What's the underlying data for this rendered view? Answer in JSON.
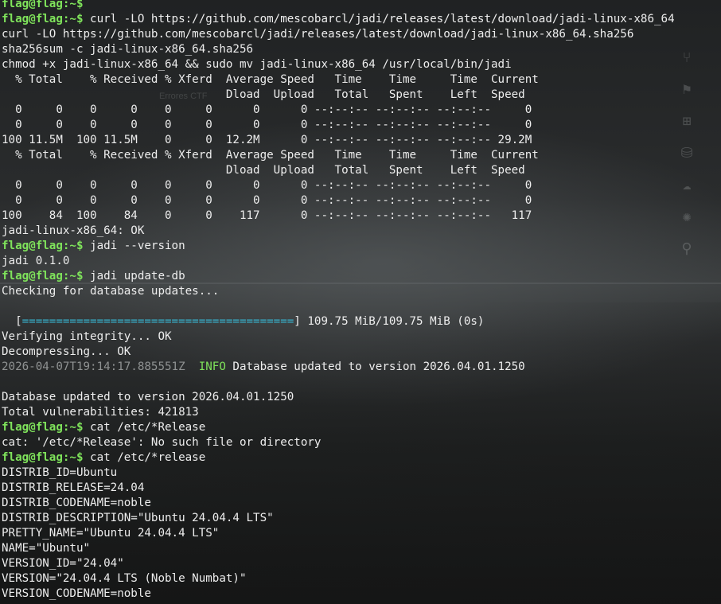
{
  "terminal": {
    "prompt": "flag@flag:~$",
    "lines": [
      {
        "type": "prompt",
        "cmd": ""
      },
      {
        "type": "prompt",
        "cmd": " curl -LO https://github.com/mescobarcl/jadi/releases/latest/download/jadi-linux-x86_64"
      },
      {
        "type": "text",
        "text": "curl -LO https://github.com/mescobarcl/jadi/releases/latest/download/jadi-linux-x86_64.sha256"
      },
      {
        "type": "text",
        "text": "sha256sum -c jadi-linux-x86_64.sha256"
      },
      {
        "type": "text",
        "text": "chmod +x jadi-linux-x86_64 && sudo mv jadi-linux-x86_64 /usr/local/bin/jadi"
      },
      {
        "type": "text",
        "text": "  % Total    % Received % Xferd  Average Speed   Time    Time     Time  Current"
      },
      {
        "type": "text",
        "text": "                                 Dload  Upload   Total   Spent    Left  Speed"
      },
      {
        "type": "text",
        "text": "  0     0    0     0    0     0      0      0 --:--:-- --:--:-- --:--:--     0"
      },
      {
        "type": "text",
        "text": "  0     0    0     0    0     0      0      0 --:--:-- --:--:-- --:--:--     0"
      },
      {
        "type": "text",
        "text": "100 11.5M  100 11.5M    0     0  12.2M      0 --:--:-- --:--:-- --:--:-- 29.2M"
      },
      {
        "type": "text",
        "text": "  % Total    % Received % Xferd  Average Speed   Time    Time     Time  Current"
      },
      {
        "type": "text",
        "text": "                                 Dload  Upload   Total   Spent    Left  Speed"
      },
      {
        "type": "text",
        "text": "  0     0    0     0    0     0      0      0 --:--:-- --:--:-- --:--:--     0"
      },
      {
        "type": "text",
        "text": "  0     0    0     0    0     0      0      0 --:--:-- --:--:-- --:--:--     0"
      },
      {
        "type": "text",
        "text": "100    84  100    84    0     0    117      0 --:--:-- --:--:-- --:--:--   117"
      },
      {
        "type": "text",
        "text": "jadi-linux-x86_64: OK"
      },
      {
        "type": "prompt",
        "cmd": " jadi --version"
      },
      {
        "type": "text",
        "text": "jadi 0.1.0"
      },
      {
        "type": "prompt",
        "cmd": " jadi update-db"
      },
      {
        "type": "text",
        "text": "Checking for database updates..."
      },
      {
        "type": "text",
        "text": ""
      },
      {
        "type": "progress",
        "open": "  [",
        "bar": "========================================",
        "close": "] 109.75 MiB/109.75 MiB (0s)"
      },
      {
        "type": "text",
        "text": "Verifying integrity... OK"
      },
      {
        "type": "text",
        "text": "Decompressing... OK"
      },
      {
        "type": "log",
        "timestamp": "2026-04-07T19:14:17.885551Z",
        "level": "INFO",
        "message": " Database updated to version 2026.04.01.1250"
      },
      {
        "type": "text",
        "text": ""
      },
      {
        "type": "text",
        "text": "Database updated to version 2026.04.01.1250"
      },
      {
        "type": "text",
        "text": "Total vulnerabilities: 421813"
      },
      {
        "type": "prompt",
        "cmd": " cat /etc/*Release"
      },
      {
        "type": "text",
        "text": "cat: '/etc/*Release': No such file or directory"
      },
      {
        "type": "prompt",
        "cmd": " cat /etc/*release"
      },
      {
        "type": "text",
        "text": "DISTRIB_ID=Ubuntu"
      },
      {
        "type": "text",
        "text": "DISTRIB_RELEASE=24.04"
      },
      {
        "type": "text",
        "text": "DISTRIB_CODENAME=noble"
      },
      {
        "type": "text",
        "text": "DISTRIB_DESCRIPTION=\"Ubuntu 24.04.4 LTS\""
      },
      {
        "type": "text",
        "text": "PRETTY_NAME=\"Ubuntu 24.04.4 LTS\""
      },
      {
        "type": "text",
        "text": "NAME=\"Ubuntu\""
      },
      {
        "type": "text",
        "text": "VERSION_ID=\"24.04\""
      },
      {
        "type": "text",
        "text": "VERSION=\"24.04.4 LTS (Noble Numbat)\""
      },
      {
        "type": "text",
        "text": "VERSION_CODENAME=noble"
      }
    ]
  },
  "background": {
    "ghost_text": "Errores CTF"
  },
  "side_icons": [
    "git-branch-icon",
    "bug-icon",
    "extensions-icon",
    "database-icon",
    "aws-icon",
    "gear-burst-icon",
    "share-icon"
  ],
  "colors": {
    "prompt": "#7fe35b",
    "progress_bar": "#37b3cf",
    "timestamp": "#8f9292",
    "text": "#ededed"
  },
  "progress": {
    "fraction": 1.0
  }
}
